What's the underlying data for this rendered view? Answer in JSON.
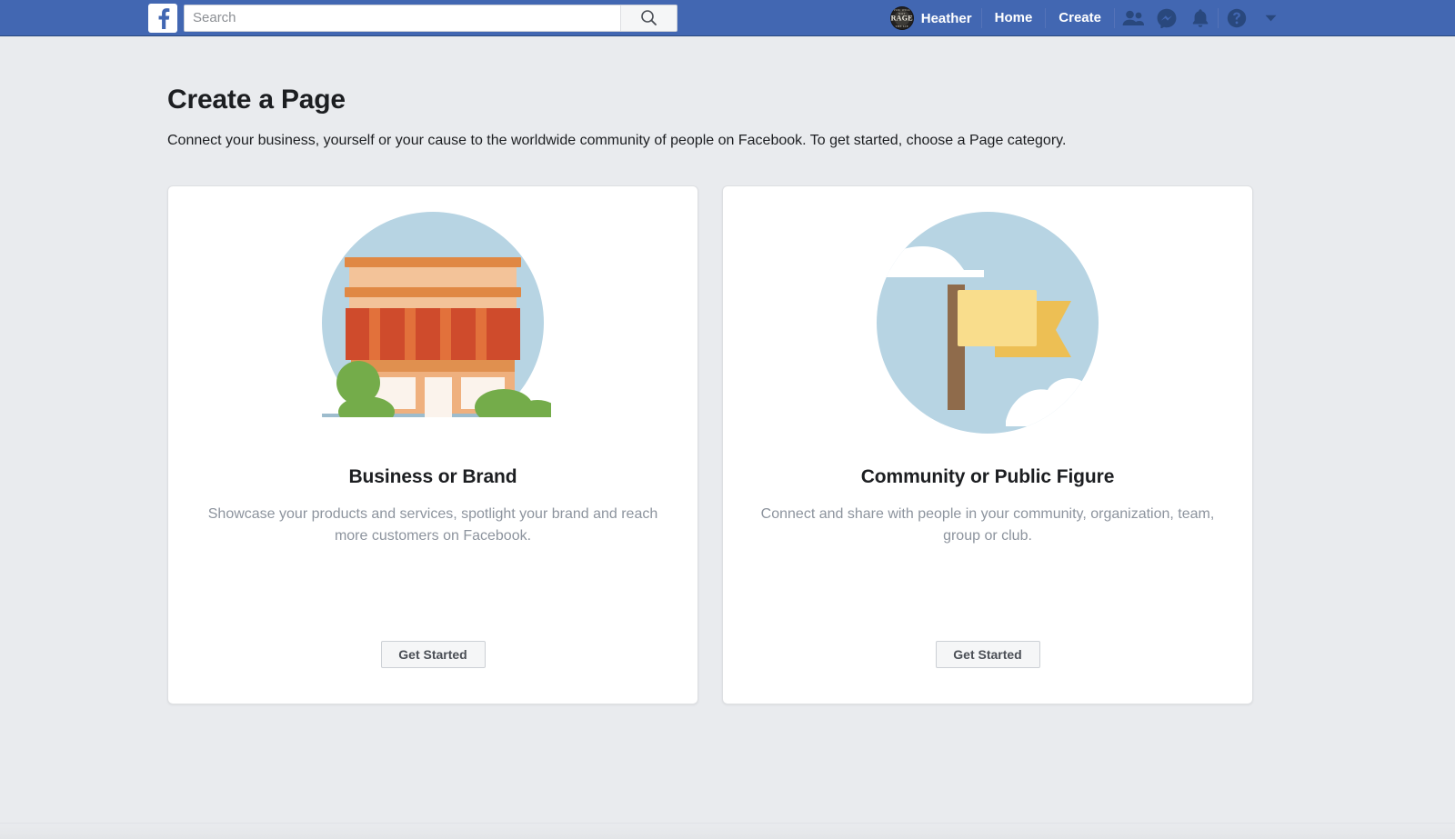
{
  "nav": {
    "logo_alt": "Facebook",
    "search": {
      "value": "",
      "placeholder": "Search"
    },
    "profile_name": "Heather",
    "avatar_text": "RAGE",
    "avatar_ring_top": "YOU WILL NOT",
    "avatar_ring_bottom": "THE LIE",
    "links": [
      {
        "label": "Home"
      },
      {
        "label": "Create"
      }
    ],
    "icons": [
      {
        "name": "friend-requests-icon"
      },
      {
        "name": "messenger-icon"
      },
      {
        "name": "notifications-icon"
      },
      {
        "name": "help-icon"
      },
      {
        "name": "account-menu-caret-icon"
      }
    ]
  },
  "header": {
    "title": "Create a Page",
    "subtitle": "Connect your business, yourself or your cause to the worldwide community of people on Facebook. To get started, choose a Page category."
  },
  "cards": [
    {
      "id": "business-or-brand",
      "illustration": "storefront-illustration",
      "title": "Business or Brand",
      "description": "Showcase your products and services, spotlight your brand and reach more customers on Facebook.",
      "button": "Get Started"
    },
    {
      "id": "community-or-public-figure",
      "illustration": "flag-illustration",
      "title": "Community or Public Figure",
      "description": "Connect and share with people in your community, organization, team, group or club.",
      "button": "Get Started"
    }
  ],
  "colors": {
    "navbar": "#4267b2",
    "page_background": "#e9ebee",
    "card_background": "#ffffff",
    "title_text": "#1c1e21",
    "muted_text": "#8d949e",
    "illustration_circle": "#b7d4e3",
    "storefront_wall": "#efb07e",
    "storefront_awning": "#cf4b2c",
    "flag_front": "#f9dd8c",
    "flag_back": "#edbf54",
    "flag_pole": "#8f6b4b",
    "foliage": "#74ac4a"
  }
}
